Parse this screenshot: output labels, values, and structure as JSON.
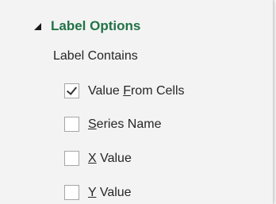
{
  "section": {
    "title": "Label Options",
    "collapse_icon": "triangle-expanded-icon"
  },
  "label_contains": {
    "heading": "Label Contains",
    "options": [
      {
        "pre": "Value ",
        "key": "F",
        "post": "rom Cells",
        "checked": true
      },
      {
        "pre": "",
        "key": "S",
        "post": "eries Name",
        "checked": false
      },
      {
        "pre": "",
        "key": "X",
        "post": " Value",
        "checked": false
      },
      {
        "pre": "",
        "key": "Y",
        "post": " Value",
        "checked": false
      }
    ]
  },
  "colors": {
    "accent": "#217346",
    "panel_bg": "#f3f3f3",
    "text": "#262626"
  }
}
